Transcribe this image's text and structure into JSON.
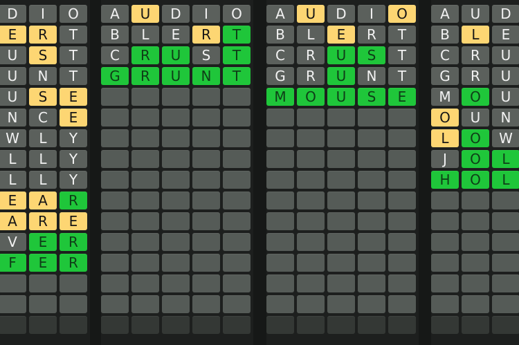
{
  "boards": [
    {
      "id": "board-1",
      "rows": [
        [
          {
            "l": "D",
            "s": "absent"
          },
          {
            "l": "I",
            "s": "absent"
          },
          {
            "l": "O",
            "s": "absent"
          }
        ],
        [
          {
            "l": "E",
            "s": "present"
          },
          {
            "l": "R",
            "s": "present"
          },
          {
            "l": "T",
            "s": "absent"
          }
        ],
        [
          {
            "l": "U",
            "s": "absent"
          },
          {
            "l": "S",
            "s": "present"
          },
          {
            "l": "T",
            "s": "absent"
          }
        ],
        [
          {
            "l": "U",
            "s": "absent"
          },
          {
            "l": "N",
            "s": "absent"
          },
          {
            "l": "T",
            "s": "absent"
          }
        ],
        [
          {
            "l": "U",
            "s": "absent"
          },
          {
            "l": "S",
            "s": "present"
          },
          {
            "l": "E",
            "s": "present"
          }
        ],
        [
          {
            "l": "N",
            "s": "absent"
          },
          {
            "l": "C",
            "s": "absent"
          },
          {
            "l": "E",
            "s": "present"
          }
        ],
        [
          {
            "l": "W",
            "s": "absent"
          },
          {
            "l": "L",
            "s": "absent"
          },
          {
            "l": "Y",
            "s": "absent"
          }
        ],
        [
          {
            "l": "L",
            "s": "absent"
          },
          {
            "l": "L",
            "s": "absent"
          },
          {
            "l": "Y",
            "s": "absent"
          }
        ],
        [
          {
            "l": "L",
            "s": "absent"
          },
          {
            "l": "L",
            "s": "absent"
          },
          {
            "l": "Y",
            "s": "absent"
          }
        ],
        [
          {
            "l": "E",
            "s": "present"
          },
          {
            "l": "A",
            "s": "present"
          },
          {
            "l": "R",
            "s": "correct"
          }
        ],
        [
          {
            "l": "A",
            "s": "present"
          },
          {
            "l": "R",
            "s": "present"
          },
          {
            "l": "E",
            "s": "present"
          }
        ],
        [
          {
            "l": "V",
            "s": "absent"
          },
          {
            "l": "E",
            "s": "correct"
          },
          {
            "l": "R",
            "s": "correct"
          }
        ],
        [
          {
            "l": "F",
            "s": "correct"
          },
          {
            "l": "E",
            "s": "correct"
          },
          {
            "l": "R",
            "s": "correct"
          }
        ],
        [
          {
            "l": "",
            "s": "empty"
          },
          {
            "l": "",
            "s": "empty"
          },
          {
            "l": "",
            "s": "empty"
          }
        ],
        [
          {
            "l": "",
            "s": "empty"
          },
          {
            "l": "",
            "s": "empty"
          },
          {
            "l": "",
            "s": "empty"
          }
        ],
        [
          {
            "l": "",
            "s": "empty dim"
          },
          {
            "l": "",
            "s": "empty dim"
          },
          {
            "l": "",
            "s": "empty dim"
          }
        ]
      ]
    },
    {
      "id": "board-2",
      "rows": [
        [
          {
            "l": "A",
            "s": "absent"
          },
          {
            "l": "U",
            "s": "present"
          },
          {
            "l": "D",
            "s": "absent"
          },
          {
            "l": "I",
            "s": "absent"
          },
          {
            "l": "O",
            "s": "absent"
          }
        ],
        [
          {
            "l": "B",
            "s": "absent"
          },
          {
            "l": "L",
            "s": "absent"
          },
          {
            "l": "E",
            "s": "absent"
          },
          {
            "l": "R",
            "s": "present"
          },
          {
            "l": "T",
            "s": "correct"
          }
        ],
        [
          {
            "l": "C",
            "s": "absent"
          },
          {
            "l": "R",
            "s": "correct"
          },
          {
            "l": "U",
            "s": "correct"
          },
          {
            "l": "S",
            "s": "absent"
          },
          {
            "l": "T",
            "s": "correct"
          }
        ],
        [
          {
            "l": "G",
            "s": "correct"
          },
          {
            "l": "R",
            "s": "correct"
          },
          {
            "l": "U",
            "s": "correct"
          },
          {
            "l": "N",
            "s": "correct"
          },
          {
            "l": "T",
            "s": "correct"
          }
        ]
      ]
    },
    {
      "id": "board-3",
      "rows": [
        [
          {
            "l": "A",
            "s": "absent"
          },
          {
            "l": "U",
            "s": "present"
          },
          {
            "l": "D",
            "s": "absent"
          },
          {
            "l": "I",
            "s": "absent"
          },
          {
            "l": "O",
            "s": "present"
          }
        ],
        [
          {
            "l": "B",
            "s": "absent"
          },
          {
            "l": "L",
            "s": "absent"
          },
          {
            "l": "E",
            "s": "present"
          },
          {
            "l": "R",
            "s": "absent"
          },
          {
            "l": "T",
            "s": "absent"
          }
        ],
        [
          {
            "l": "C",
            "s": "absent"
          },
          {
            "l": "R",
            "s": "absent"
          },
          {
            "l": "U",
            "s": "correct"
          },
          {
            "l": "S",
            "s": "correct"
          },
          {
            "l": "T",
            "s": "absent"
          }
        ],
        [
          {
            "l": "G",
            "s": "absent"
          },
          {
            "l": "R",
            "s": "absent"
          },
          {
            "l": "U",
            "s": "correct"
          },
          {
            "l": "N",
            "s": "absent"
          },
          {
            "l": "T",
            "s": "absent"
          }
        ],
        [
          {
            "l": "M",
            "s": "correct"
          },
          {
            "l": "O",
            "s": "correct"
          },
          {
            "l": "U",
            "s": "correct"
          },
          {
            "l": "S",
            "s": "correct"
          },
          {
            "l": "E",
            "s": "correct"
          }
        ]
      ]
    },
    {
      "id": "board-4",
      "rows": [
        [
          {
            "l": "A",
            "s": "absent"
          },
          {
            "l": "U",
            "s": "absent"
          },
          {
            "l": "D",
            "s": "absent"
          }
        ],
        [
          {
            "l": "B",
            "s": "absent"
          },
          {
            "l": "L",
            "s": "present"
          },
          {
            "l": "E",
            "s": "absent"
          }
        ],
        [
          {
            "l": "C",
            "s": "absent"
          },
          {
            "l": "R",
            "s": "absent"
          },
          {
            "l": "U",
            "s": "absent"
          }
        ],
        [
          {
            "l": "G",
            "s": "absent"
          },
          {
            "l": "R",
            "s": "absent"
          },
          {
            "l": "U",
            "s": "absent"
          }
        ],
        [
          {
            "l": "M",
            "s": "absent"
          },
          {
            "l": "O",
            "s": "correct"
          },
          {
            "l": "U",
            "s": "absent"
          }
        ],
        [
          {
            "l": "O",
            "s": "present"
          },
          {
            "l": "U",
            "s": "absent"
          },
          {
            "l": "N",
            "s": "absent"
          }
        ],
        [
          {
            "l": "L",
            "s": "present"
          },
          {
            "l": "O",
            "s": "correct"
          },
          {
            "l": "W",
            "s": "absent"
          }
        ],
        [
          {
            "l": "J",
            "s": "absent"
          },
          {
            "l": "O",
            "s": "correct"
          },
          {
            "l": "L",
            "s": "correct"
          }
        ],
        [
          {
            "l": "H",
            "s": "correct"
          },
          {
            "l": "O",
            "s": "correct"
          },
          {
            "l": "L",
            "s": "correct"
          }
        ]
      ]
    }
  ],
  "colors": {
    "absent": "#5b605c",
    "present": "#fdd673",
    "correct": "#1fc63a",
    "empty": "#555b57"
  }
}
